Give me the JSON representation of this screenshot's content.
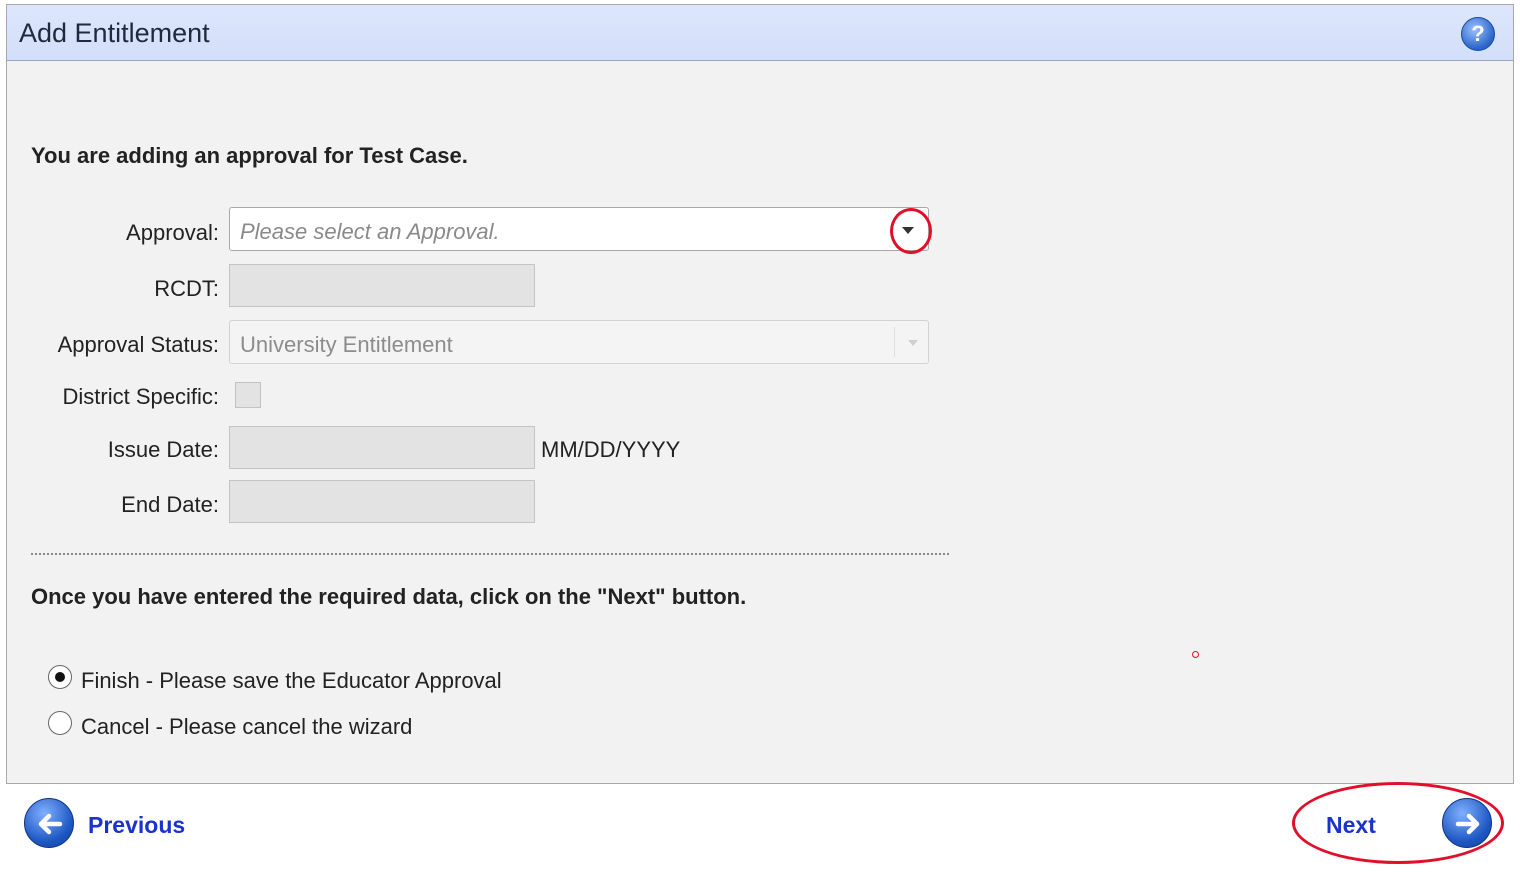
{
  "window": {
    "title": "Add Entitlement",
    "help_icon": "help-icon"
  },
  "form": {
    "intro": "You are adding an approval for Test Case.",
    "approval_label": "Approval:",
    "approval_placeholder": "Please select an Approval.",
    "rcdt_label": "RCDT:",
    "approval_status_label": "Approval Status:",
    "approval_status_value": "University Entitlement",
    "district_specific_label": "District Specific:",
    "issue_date_label": "Issue Date:",
    "issue_date_hint": "MM/DD/YYYY",
    "end_date_label": "End Date:"
  },
  "instruction": "Once you have entered the required data, click on the \"Next\" button.",
  "options": [
    {
      "label": "Finish - Please save the Educator Approval",
      "selected": true
    },
    {
      "label": "Cancel - Please cancel the wizard",
      "selected": false
    }
  ],
  "nav": {
    "previous_label": "Previous",
    "next_label": "Next",
    "previous_icon": "arrow-left-icon",
    "next_icon": "arrow-right-icon"
  },
  "colors": {
    "titlebar": "#d3defa",
    "link": "#1a33cc",
    "annotation": "#e0102a"
  }
}
